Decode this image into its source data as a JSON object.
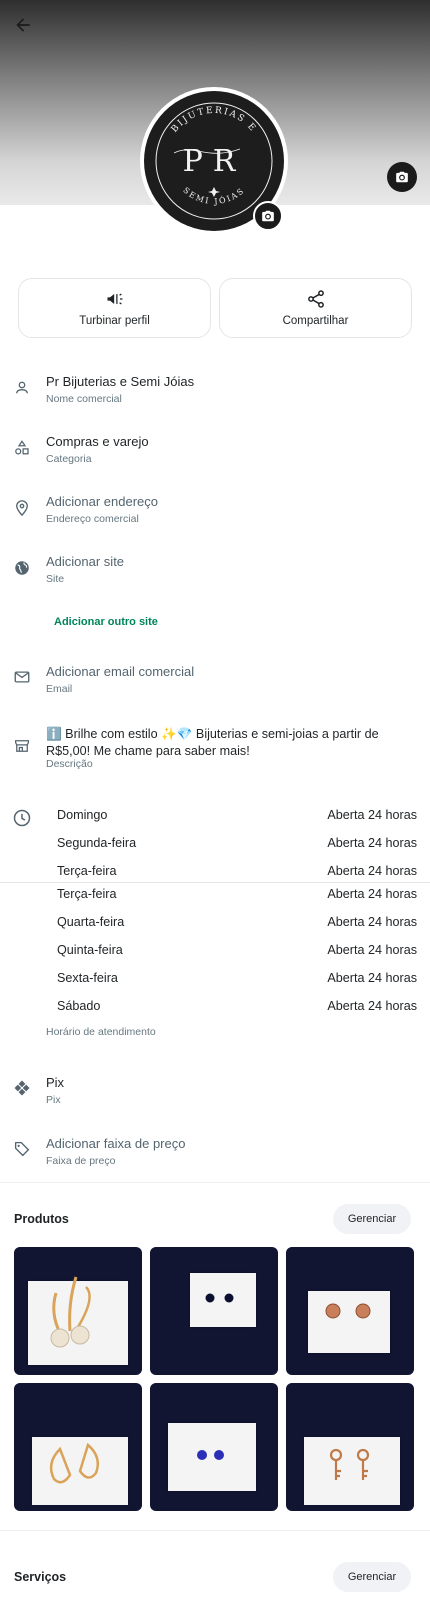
{
  "header": {
    "back_icon": "arrow-left-icon",
    "logo_text": {
      "top_arc": "BIJUTERIAS E",
      "bottom_arc": "SEMI JÓIAS",
      "monogram": "PR"
    }
  },
  "actions": [
    {
      "label": "Turbinar perfil",
      "icon": "megaphone-icon"
    },
    {
      "label": "Compartilhar",
      "icon": "share-icon"
    }
  ],
  "profile": {
    "name": {
      "title": "Pr Bijuterias e Semi Jóias",
      "sub": "Nome comercial"
    },
    "category": {
      "title": "Compras e varejo",
      "sub": "Categoria"
    },
    "address": {
      "title": "Adicionar endereço",
      "sub": "Endereço comercial"
    },
    "site": {
      "title": "Adicionar site",
      "sub": "Site",
      "add_other": "Adicionar outro site"
    },
    "email": {
      "title": "Adicionar email comercial",
      "sub": "Email"
    },
    "description": {
      "text": "ℹ️ Brilhe com estilo ✨💎 Bijuterias e semi-joias a partir de R$5,00! Me chame para saber mais!",
      "sub": "Descrição"
    },
    "pix": {
      "title": "Pix",
      "sub": "Pix"
    },
    "price": {
      "title": "Adicionar faixa de preço",
      "sub": "Faixa de preço"
    }
  },
  "hours": {
    "caption": "Horário de atendimento",
    "rows": [
      {
        "day": "Domingo",
        "value": "Aberta 24 horas"
      },
      {
        "day": "Segunda-feira",
        "value": "Aberta 24 horas"
      },
      {
        "day": "Terça-feira",
        "value": "Aberta 24 horas"
      },
      {
        "day": "Terça-feira",
        "value": "Aberta 24 horas"
      },
      {
        "day": "Quarta-feira",
        "value": "Aberta 24 horas"
      },
      {
        "day": "Quinta-feira",
        "value": "Aberta 24 horas"
      },
      {
        "day": "Sexta-feira",
        "value": "Aberta 24 horas"
      },
      {
        "day": "Sábado",
        "value": "Aberta 24 horas"
      }
    ]
  },
  "products": {
    "title": "Produtos",
    "manage_label": "Gerenciar",
    "items": [
      {
        "kind": "pearl-hoop-earrings"
      },
      {
        "kind": "black-stud-earrings"
      },
      {
        "kind": "rose-stud-earrings"
      },
      {
        "kind": "drop-hoop-earrings"
      },
      {
        "kind": "blue-stud-earrings"
      },
      {
        "kind": "key-earrings"
      }
    ]
  },
  "services": {
    "title": "Serviços",
    "manage_label": "Gerenciar"
  },
  "colors": {
    "accent_green": "#00855b",
    "product_bg": "#111531",
    "muted_text": "#667781"
  }
}
